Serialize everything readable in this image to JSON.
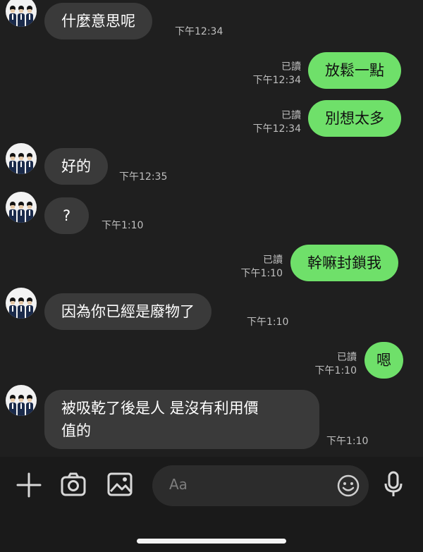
{
  "messages": [
    {
      "dir": "in",
      "text": "什麼意思呢",
      "time": "下午12:34"
    },
    {
      "dir": "out",
      "text": "放鬆一點",
      "read": "已讀",
      "time": "下午12:34"
    },
    {
      "dir": "out",
      "text": "別想太多",
      "read": "已讀",
      "time": "下午12:34"
    },
    {
      "dir": "in",
      "text": "好的",
      "time": "下午12:35"
    },
    {
      "dir": "in",
      "text": "?",
      "time": "下午1:10"
    },
    {
      "dir": "out",
      "text": "幹嘛封鎖我",
      "read": "已讀",
      "time": "下午1:10"
    },
    {
      "dir": "in",
      "text": "因為你已經是廢物了",
      "time": "下午1:10"
    },
    {
      "dir": "out",
      "text": "嗯",
      "read": "已讀",
      "time": "下午1:10"
    },
    {
      "dir": "in",
      "line1": "被吸乾了後是人 是沒有利用價",
      "line2": "值的",
      "time": "下午1:10"
    }
  ],
  "composer": {
    "placeholder": "Aa",
    "icons": [
      "plus-icon",
      "camera-icon",
      "image-icon",
      "emoji-icon",
      "microphone-icon"
    ]
  },
  "colors": {
    "background": "#1f1f1f",
    "incoming": "#3a3a3a",
    "outgoing": "#6fe06a"
  }
}
